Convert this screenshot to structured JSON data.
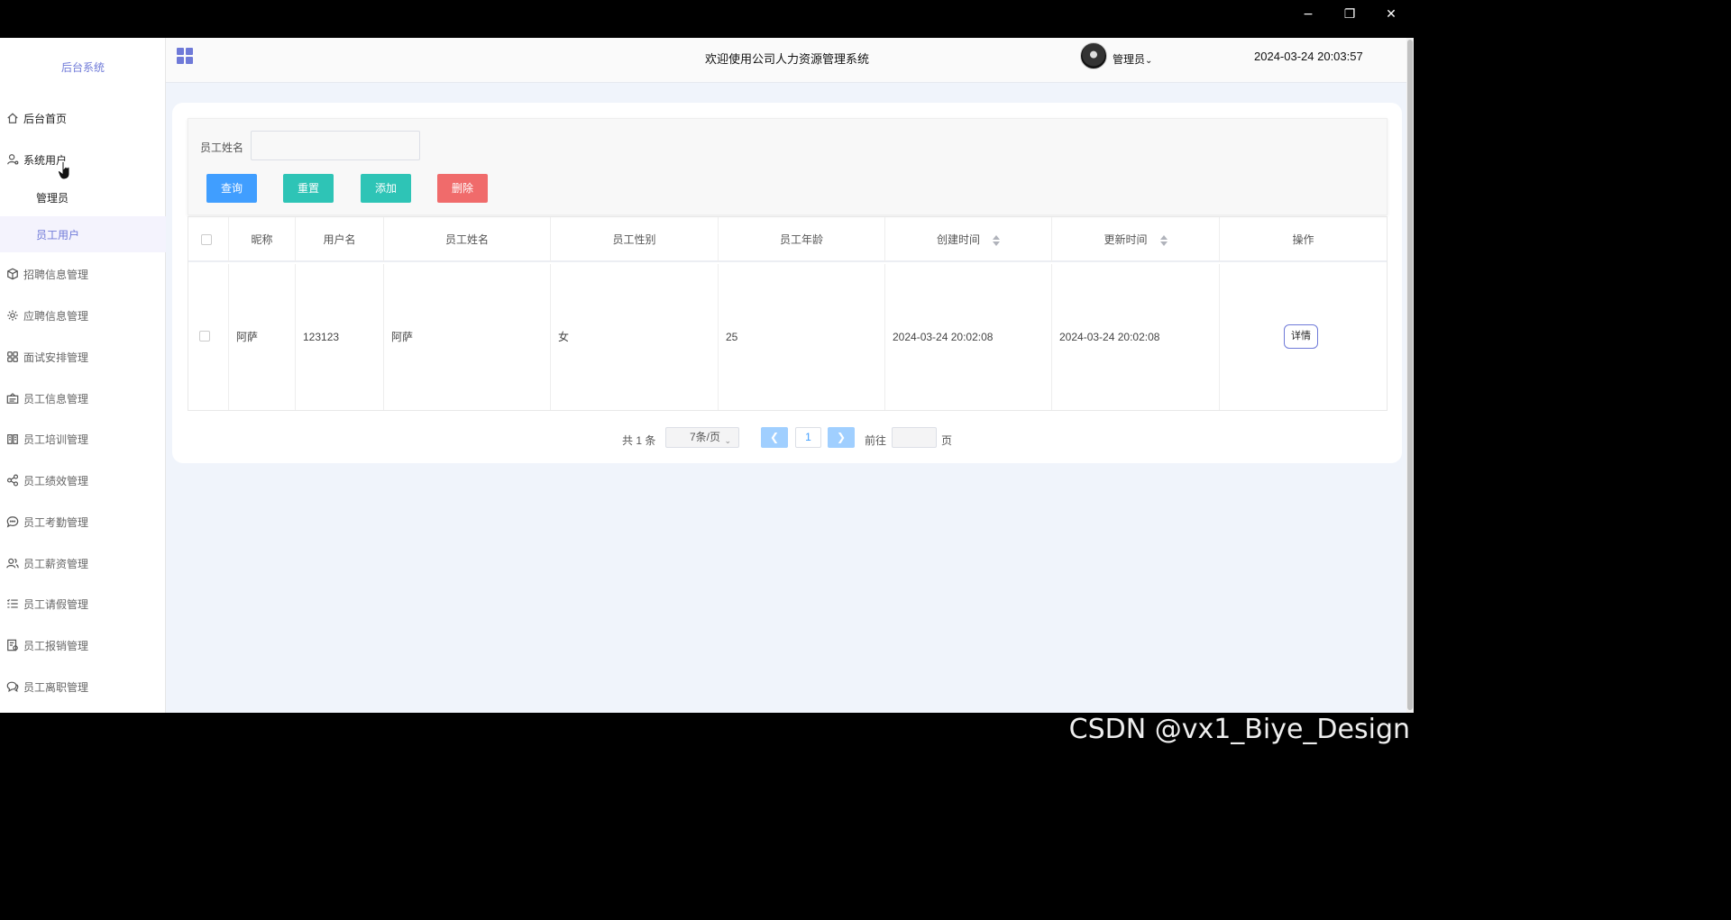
{
  "window": {
    "minimize": "−",
    "restore": "❐",
    "close": "✕"
  },
  "sidebar": {
    "brand": "后台系统",
    "home": "后台首页",
    "system_users": "系统用户",
    "sub": [
      "管理员",
      "员工用户"
    ],
    "items": [
      {
        "label": "招聘信息管理",
        "icon": "cube-icon"
      },
      {
        "label": "应聘信息管理",
        "icon": "gear-icon"
      },
      {
        "label": "面试安排管理",
        "icon": "grid-icon"
      },
      {
        "label": "员工信息管理",
        "icon": "id-card-icon"
      },
      {
        "label": "员工培训管理",
        "icon": "book-icon"
      },
      {
        "label": "员工绩效管理",
        "icon": "share-icon"
      },
      {
        "label": "员工考勤管理",
        "icon": "chat-icon"
      },
      {
        "label": "员工薪资管理",
        "icon": "users-icon"
      },
      {
        "label": "员工请假管理",
        "icon": "list-icon"
      },
      {
        "label": "员工报销管理",
        "icon": "receipt-icon"
      },
      {
        "label": "员工离职管理",
        "icon": "chat-bubbles-icon"
      }
    ]
  },
  "header": {
    "title": "欢迎使用公司人力资源管理系统",
    "user": "管理员",
    "datetime": "2024-03-24 20:03:57"
  },
  "search": {
    "label": "员工姓名",
    "value": "",
    "buttons": {
      "query": "查询",
      "reset": "重置",
      "add": "添加",
      "delete": "删除"
    }
  },
  "colors": {
    "accent": "#6f7ad8",
    "query": "#409eff",
    "reset": "#2ec4b6",
    "add": "#2ec4b6",
    "delete": "#f06b6b"
  },
  "table": {
    "headers": [
      "昵称",
      "用户名",
      "员工姓名",
      "员工性别",
      "员工年龄",
      "创建时间",
      "更新时间",
      "操作"
    ],
    "rows": [
      {
        "nickname": "阿萨",
        "username": "123123",
        "name": "阿萨",
        "gender": "女",
        "age": "25",
        "created": "2024-03-24 20:02:08",
        "updated": "2024-03-24 20:02:08",
        "action": "详情"
      }
    ]
  },
  "pagination": {
    "total": "共 1 条",
    "page_size": "7条/页",
    "current": "1",
    "goto": "前往",
    "page_unit": "页"
  },
  "watermark": "CSDN @vx1_Biye_Design"
}
